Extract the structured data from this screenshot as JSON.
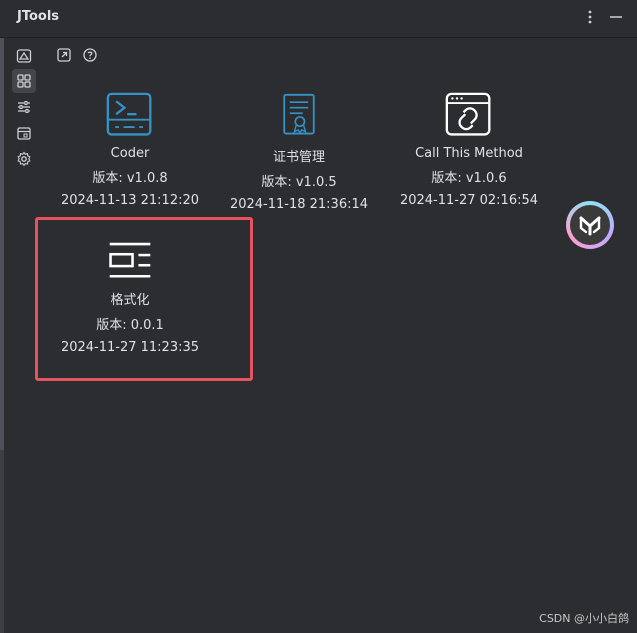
{
  "window": {
    "title": "JTools"
  },
  "header_icons": [
    "more-vertical-icon",
    "minimize-icon"
  ],
  "sidebar": {
    "items": [
      {
        "name": "home-icon",
        "active": false
      },
      {
        "name": "grid-icon",
        "active": true
      },
      {
        "name": "sliders-icon",
        "active": false
      },
      {
        "name": "calendar-icon",
        "active": false
      },
      {
        "name": "gear-icon",
        "active": false
      }
    ]
  },
  "toolbar": {
    "items": [
      "open-external-icon",
      "help-icon"
    ]
  },
  "plugins": [
    {
      "name": "Coder",
      "version": "版本: v1.0.8",
      "date": "2024-11-13 21:12:20",
      "icon": "terminal-icon",
      "accent": "#3592c4"
    },
    {
      "name": "证书管理",
      "version": "版本: v1.0.5",
      "date": "2024-11-18 21:36:14",
      "icon": "certificate-icon",
      "accent": "#3592c4"
    },
    {
      "name": "Call This Method",
      "version": "版本: v1.0.6",
      "date": "2024-11-27 02:16:54",
      "icon": "browser-link-icon",
      "accent": "#ffffff"
    },
    {
      "name": "格式化",
      "version": "版本: 0.0.1",
      "date": "2024-11-27 11:23:35",
      "icon": "format-icon",
      "accent": "#ffffff"
    }
  ],
  "watermark": "CSDN @小小白鸽",
  "colors": {
    "background": "#2b2d30",
    "text": "#dfe1e5",
    "highlight": "#e8525f",
    "accent": "#3592c4"
  }
}
